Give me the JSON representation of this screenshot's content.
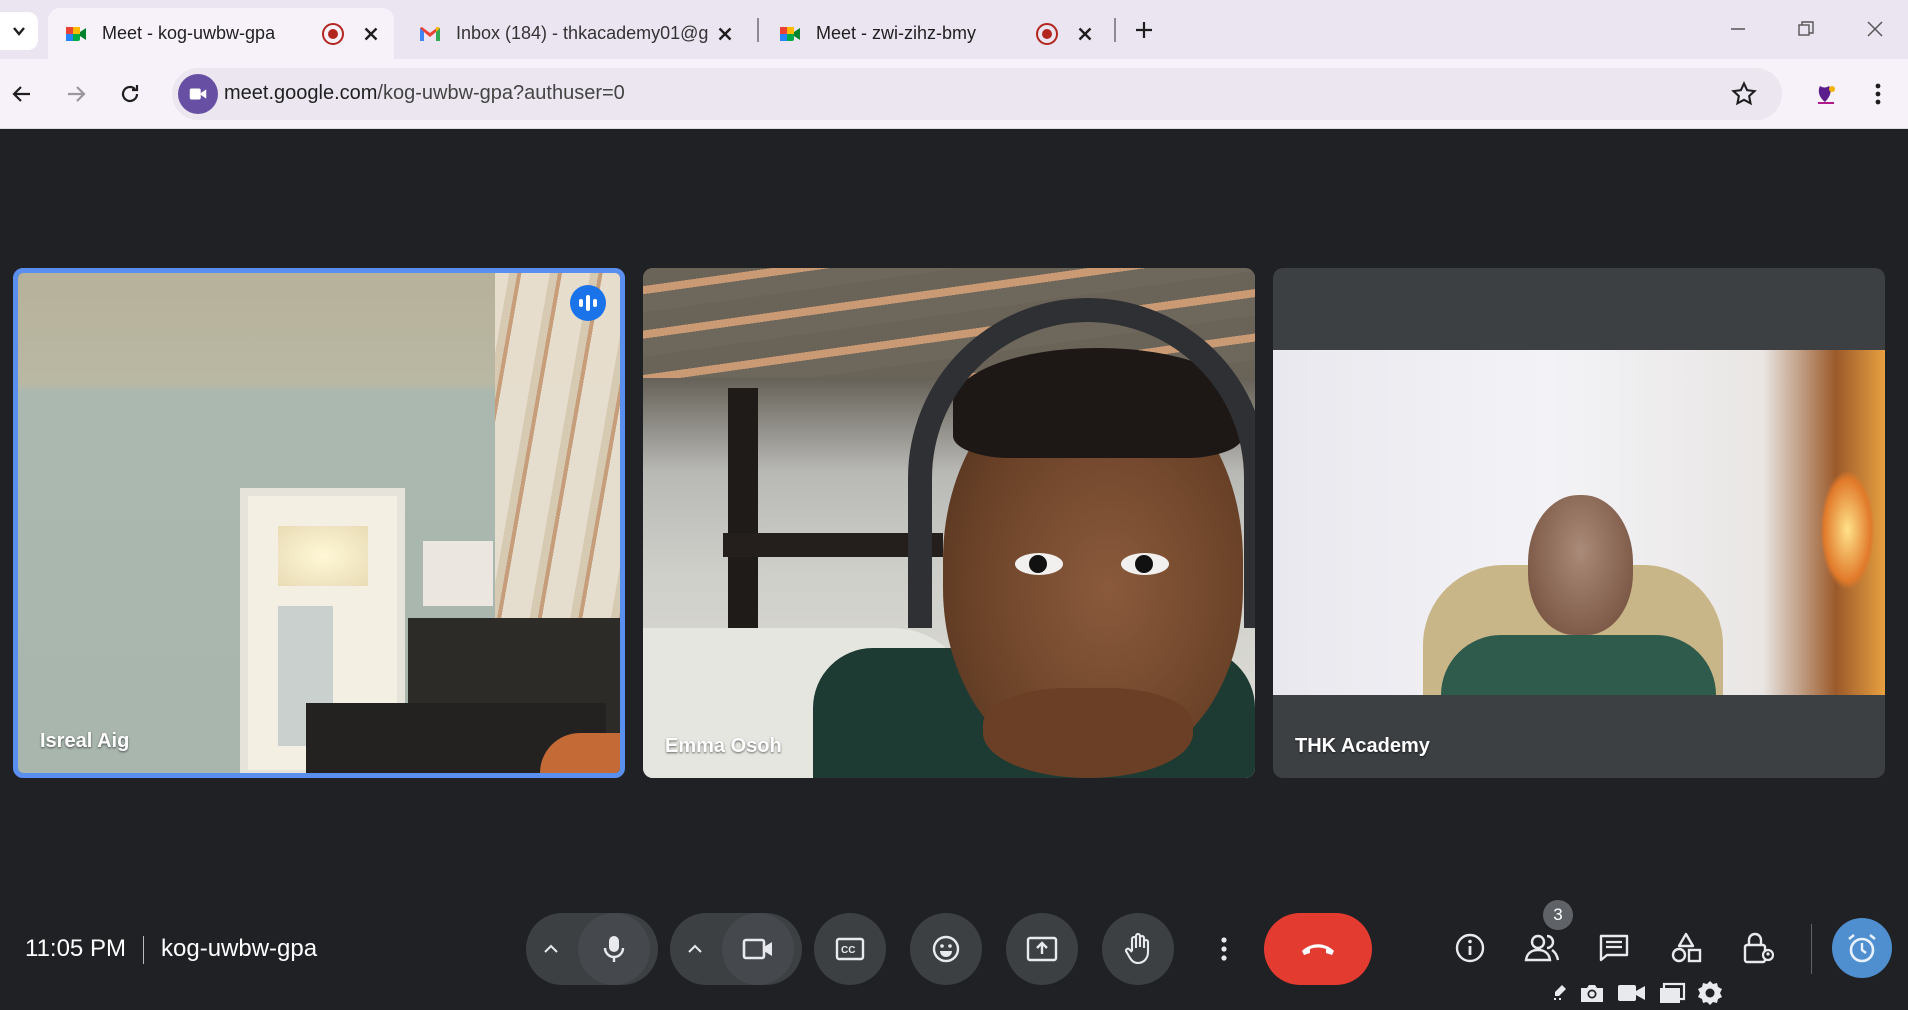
{
  "browser": {
    "tabs": [
      {
        "title": "Meet - kog-uwbw-gpa",
        "recording": true,
        "active": true
      },
      {
        "title": "Inbox (184) - thkacademy01@g",
        "recording": false,
        "active": false
      },
      {
        "title": "Meet - zwi-zihz-bmy",
        "recording": true,
        "active": false
      }
    ],
    "url_host": "meet.google.com",
    "url_path": "/kog-uwbw-gpa?authuser=0"
  },
  "participants": [
    {
      "name": "Isreal Aig",
      "speaking": true
    },
    {
      "name": "Emma Osoh",
      "speaking": false
    },
    {
      "name": "THK Academy",
      "speaking": false
    }
  ],
  "bottom_bar": {
    "time": "11:05 PM",
    "meeting_code": "kog-uwbw-gpa",
    "people_count": "3"
  },
  "colors": {
    "accent_blue": "#1a73e8",
    "end_call_red": "#e33b30",
    "tab_strip": "#ebe4f1",
    "stage_bg": "#202124"
  },
  "icons": [
    "tab-list-icon",
    "meet-favicon",
    "gmail-favicon",
    "record-icon",
    "close-icon",
    "plus-icon",
    "minimize-icon",
    "restore-icon",
    "back-icon",
    "forward-icon",
    "reload-icon",
    "site-info-icon",
    "star-icon",
    "profile-icon",
    "more-vert-icon",
    "speaking-indicator-icon",
    "microphone-icon",
    "camera-icon",
    "captions-icon",
    "emoji-icon",
    "present-icon",
    "raise-hand-icon",
    "end-call-icon",
    "info-icon",
    "people-icon",
    "chat-icon",
    "activities-icon",
    "host-controls-icon",
    "alarm-icon",
    "settings-icon"
  ]
}
